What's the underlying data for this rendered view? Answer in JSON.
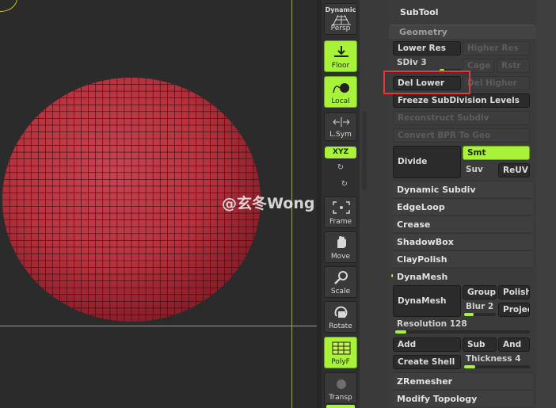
{
  "shelf": {
    "dynamic": "Dynamic",
    "persp": "Persp",
    "floor": "Floor",
    "local": "Local",
    "lsym": "L.Sym",
    "xyz": "XYZ",
    "frame": "Frame",
    "move": "Move",
    "scale": "Scale",
    "rotate": "Rotate",
    "polyf": "PolyF",
    "transp": "Transp"
  },
  "panel": {
    "subtool_title": "SubTool",
    "geometry_title": "Geometry",
    "lower_res": "Lower Res",
    "higher_res": "Higher Res",
    "sdiv": "SDiv 3",
    "cage": "Cage",
    "rstr": "Rstr",
    "del_lower": "Del Lower",
    "del_higher": "Del Higher",
    "freeze": "Freeze SubDivision Levels",
    "reconstruct": "Reconstruct Subdiv",
    "convert_bpr": "Convert BPR To Geo",
    "divide": "Divide",
    "smt": "Smt",
    "suv": "Suv",
    "reuv": "ReUV",
    "dynamic_subdiv": "Dynamic Subdiv",
    "edgeloop": "EdgeLoop",
    "crease": "Crease",
    "shadowbox": "ShadowBox",
    "claypolish": "ClayPolish",
    "dynamesh_title": "DynaMesh",
    "dynamesh_btn": "DynaMesh",
    "groups": "Groups",
    "polish": "Polish",
    "blur": "Blur 2",
    "project": "Projec",
    "resolution": "Resolution 128",
    "add": "Add",
    "sub": "Sub",
    "and": "And",
    "create_shell": "Create Shell",
    "thickness": "Thickness 4",
    "zremesher": "ZRemesher",
    "modify_topology": "Modify Topology"
  },
  "sliders": {
    "sdiv_level": 0.2,
    "blur_level": 0.3,
    "resolution_level": 0.08,
    "thickness_level": 0.17
  },
  "watermark": "@玄冬Wong",
  "colors": {
    "accent_green": "#a8f23a",
    "sphere_red": "#b8333f",
    "highlight_red": "#e23a3a"
  }
}
